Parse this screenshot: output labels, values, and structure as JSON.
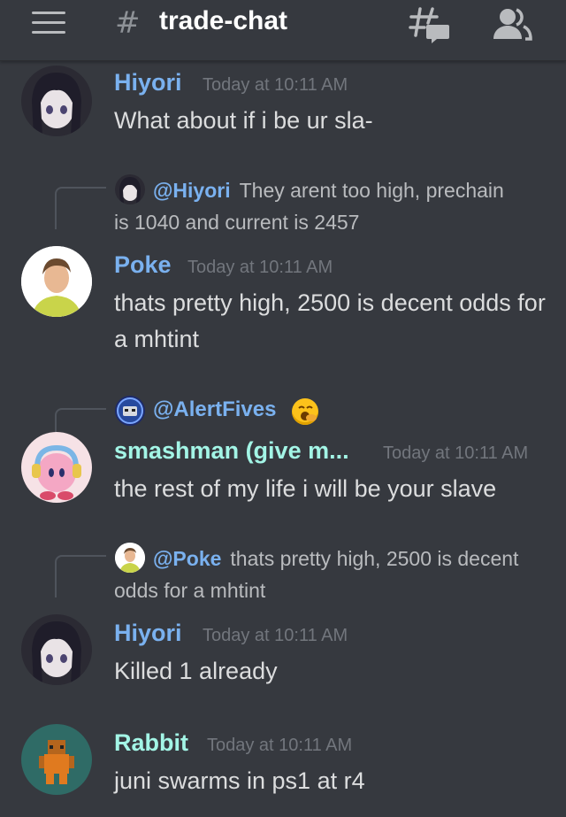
{
  "header": {
    "channel_name": "trade-chat",
    "hash_symbol": "#",
    "icons": [
      "menu-icon",
      "threads-icon",
      "members-icon"
    ]
  },
  "colors": {
    "background": "#36393f",
    "hiyori": "#7ab1ef",
    "poke": "#7ab1ef",
    "smashman": "#a3f5e6",
    "rabbit": "#a3f5e6",
    "timestamp": "#72767d",
    "mention": "#7ab1ef"
  },
  "messages": [
    {
      "username": "Hiyori",
      "timestamp": "Today at 10:11 AM",
      "content": "What about if i be ur sla-"
    },
    {
      "reply": {
        "mention": "@Hiyori",
        "text": "They arent too high, prechain is 1040 and current is 2457"
      },
      "username": "Poke",
      "timestamp": "Today at 10:11 AM",
      "content": "thats pretty high, 2500 is decent odds for a mhtint"
    },
    {
      "reply": {
        "mention": "@AlertFives",
        "text": ""
      },
      "username": "smashman (give m...",
      "timestamp": "Today at 10:11 AM",
      "content": "the rest of my life i will be your slave"
    },
    {
      "reply": {
        "mention": "@Poke",
        "text": "thats pretty high, 2500 is decent odds for a mhtint"
      },
      "username": "Hiyori",
      "timestamp": "Today at 10:11 AM",
      "content": "Killed 1 already"
    },
    {
      "username": "Rabbit",
      "timestamp": "Today at 10:11 AM",
      "content": "juni swarms in ps1 at r4"
    }
  ]
}
